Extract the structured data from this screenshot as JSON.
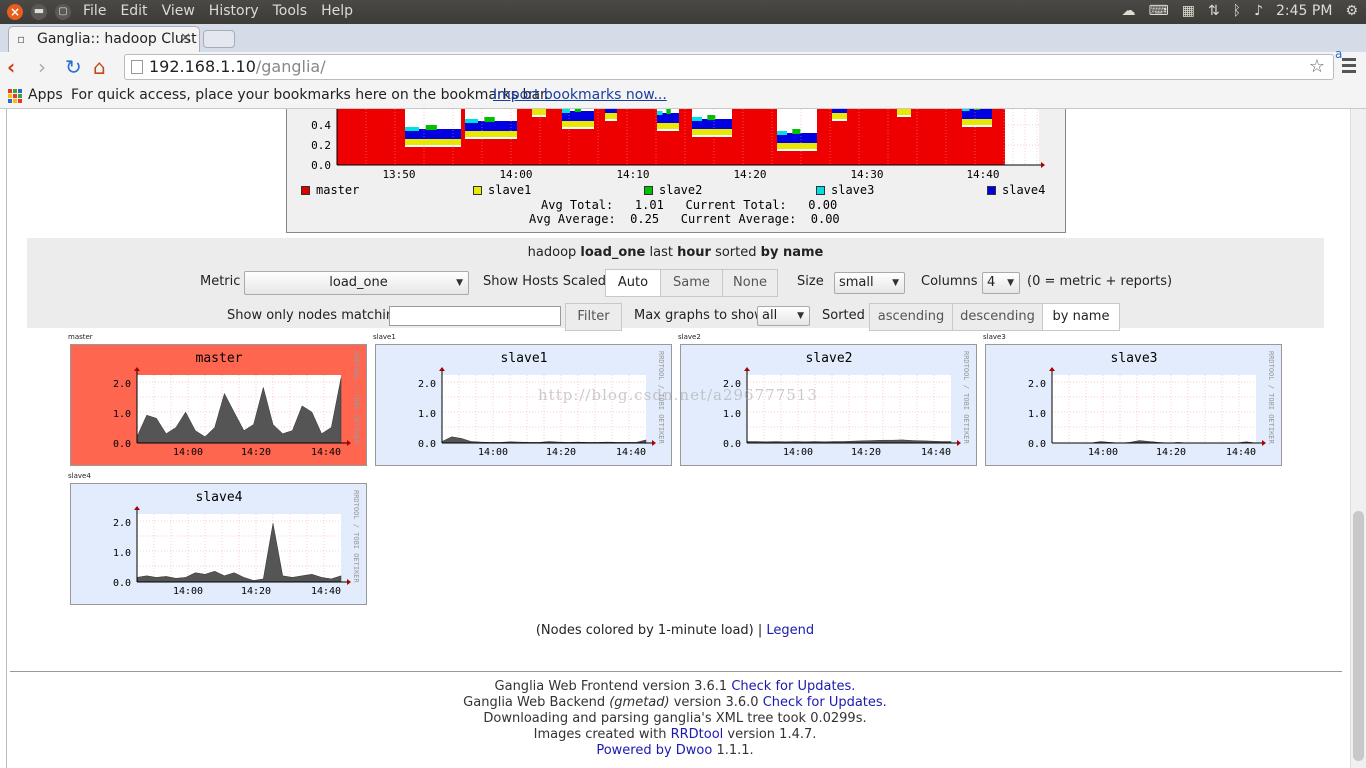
{
  "panel": {
    "menus": [
      "File",
      "Edit",
      "View",
      "History",
      "Tools",
      "Help"
    ],
    "clock": "2:45 PM",
    "close_glyph": "×",
    "min_glyph": "▬",
    "max_glyph": "▢"
  },
  "browser": {
    "tab_title": "Ganglia:: hadoop Clust",
    "url_host": "192.168.1.10",
    "url_path": "/ganglia/",
    "ext_badge": "a",
    "bookmarks": {
      "apps_label": "Apps",
      "hint": "For quick access, place your bookmarks here on the bookmarks bar.",
      "import_link": "Import bookmarks now..."
    }
  },
  "cluster_graph": {
    "legend": [
      "master",
      "slave1",
      "slave2",
      "slave3",
      "slave4"
    ],
    "legend_colors": [
      "#dd0000",
      "#e8e800",
      "#00c000",
      "#00e0e0",
      "#0000e0"
    ],
    "stats_line1": "Avg Total:   1.01   Current Total:   0.00",
    "stats_line2": "Avg Average:  0.25   Current Average:  0.00"
  },
  "controls": {
    "title_parts": [
      "hadoop ",
      "load_one",
      " last ",
      "hour",
      " sorted ",
      "by name"
    ],
    "metric_label": "Metric",
    "metric_value": "load_one",
    "scaled_label": "Show Hosts Scaled:",
    "scaled_options": [
      "Auto",
      "Same",
      "None"
    ],
    "size_label": "Size",
    "size_value": "small",
    "columns_label": "Columns",
    "columns_value": "4",
    "columns_note": "(0 = metric + reports)",
    "filter_label": "Show only nodes matching",
    "filter_value": "",
    "filter_button": "Filter",
    "max_label": "Max graphs to show",
    "max_value": "all",
    "sorted_label": "Sorted",
    "sort_options": [
      "ascending",
      "descending",
      "by name"
    ]
  },
  "hosts": [
    {
      "caption": "master",
      "title": "master",
      "bg": "#ff6650"
    },
    {
      "caption": "slave1",
      "title": "slave1",
      "bg": "#e3ecfc"
    },
    {
      "caption": "slave2",
      "title": "slave2",
      "bg": "#e3ecfc"
    },
    {
      "caption": "slave3",
      "title": "slave3",
      "bg": "#e3ecfc"
    },
    {
      "caption": "slave4",
      "title": "slave4",
      "bg": "#e3ecfc"
    }
  ],
  "host_chart": {
    "y_ticks": [
      "2.0",
      "1.0",
      "0.0"
    ],
    "x_ticks": [
      "14:00",
      "14:20",
      "14:40"
    ],
    "side_label": "RRDTOOL / TOBI OETIKER"
  },
  "chart_data": [
    {
      "type": "area",
      "x_ticks": [
        "13:50",
        "14:00",
        "14:10",
        "14:20",
        "14:30",
        "14:40"
      ],
      "y_ticks_visible": [
        "0.4",
        "0.2",
        "0.0"
      ],
      "series": [
        {
          "name": "master"
        },
        {
          "name": "slave1"
        },
        {
          "name": "slave2"
        },
        {
          "name": "slave3"
        },
        {
          "name": "slave4"
        }
      ]
    },
    {
      "type": "area",
      "series": [
        {
          "name": "master",
          "values": [
            0.2,
            0.9,
            0.8,
            0.3,
            0.5,
            1.0,
            0.4,
            0.2,
            0.5,
            1.6,
            1.0,
            0.4,
            0.6,
            1.8,
            0.6,
            0.3,
            0.4,
            1.2,
            1.0,
            0.3,
            0.5,
            2.1
          ]
        }
      ],
      "ylim": [
        0,
        2.2
      ]
    },
    {
      "type": "area",
      "series": [
        {
          "name": "slave1",
          "values": [
            0.05,
            0.2,
            0.15,
            0.05,
            0.03,
            0.02,
            0.02,
            0.04,
            0.03,
            0.02,
            0.02,
            0.05,
            0.03,
            0.02,
            0.03,
            0.02,
            0.02,
            0.03,
            0.02,
            0.02,
            0.02,
            0.1
          ]
        }
      ],
      "ylim": [
        0,
        2.2
      ]
    },
    {
      "type": "area",
      "series": [
        {
          "name": "slave2",
          "values": [
            0.05,
            0.05,
            0.04,
            0.05,
            0.04,
            0.05,
            0.04,
            0.05,
            0.04,
            0.05,
            0.05,
            0.06,
            0.07,
            0.08,
            0.09,
            0.09,
            0.1,
            0.08,
            0.07,
            0.06,
            0.05,
            0.05
          ]
        }
      ],
      "ylim": [
        0,
        2.2
      ]
    },
    {
      "type": "area",
      "series": [
        {
          "name": "slave3",
          "values": [
            0.0,
            0.0,
            0.0,
            0.0,
            0.0,
            0.05,
            0.02,
            0.0,
            0.02,
            0.08,
            0.05,
            0.02,
            0.0,
            0.02,
            0.0,
            0.0,
            0.0,
            0.0,
            0.0,
            0.0,
            0.04,
            0.0
          ]
        }
      ],
      "ylim": [
        0,
        2.2
      ]
    },
    {
      "type": "area",
      "series": [
        {
          "name": "slave4",
          "values": [
            0.15,
            0.2,
            0.15,
            0.18,
            0.12,
            0.15,
            0.3,
            0.25,
            0.35,
            0.2,
            0.3,
            0.15,
            0.05,
            0.1,
            1.9,
            0.2,
            0.15,
            0.2,
            0.25,
            0.15,
            0.1,
            0.2
          ]
        }
      ],
      "ylim": [
        0,
        2.2
      ]
    }
  ],
  "watermark": "http://blog.csdn.net/a296777513",
  "node_note": {
    "text": "(Nodes colored by 1-minute load) | ",
    "link": "Legend"
  },
  "footer": {
    "l1_text": "Ganglia Web Frontend version 3.6.1 ",
    "l1_link": "Check for Updates.",
    "l2_a": "Ganglia Web Backend ",
    "l2_em": "(gmetad)",
    "l2_b": " version 3.6.0 ",
    "l2_link": "Check for Updates.",
    "l3": "Downloading and parsing ganglia's XML tree took 0.0299s.",
    "l4_a": "Images created with ",
    "l4_link": "RRDtool",
    "l4_b": " version 1.4.7.",
    "l5_link": "Powered by Dwoo",
    "l5_b": " 1.1.1."
  }
}
